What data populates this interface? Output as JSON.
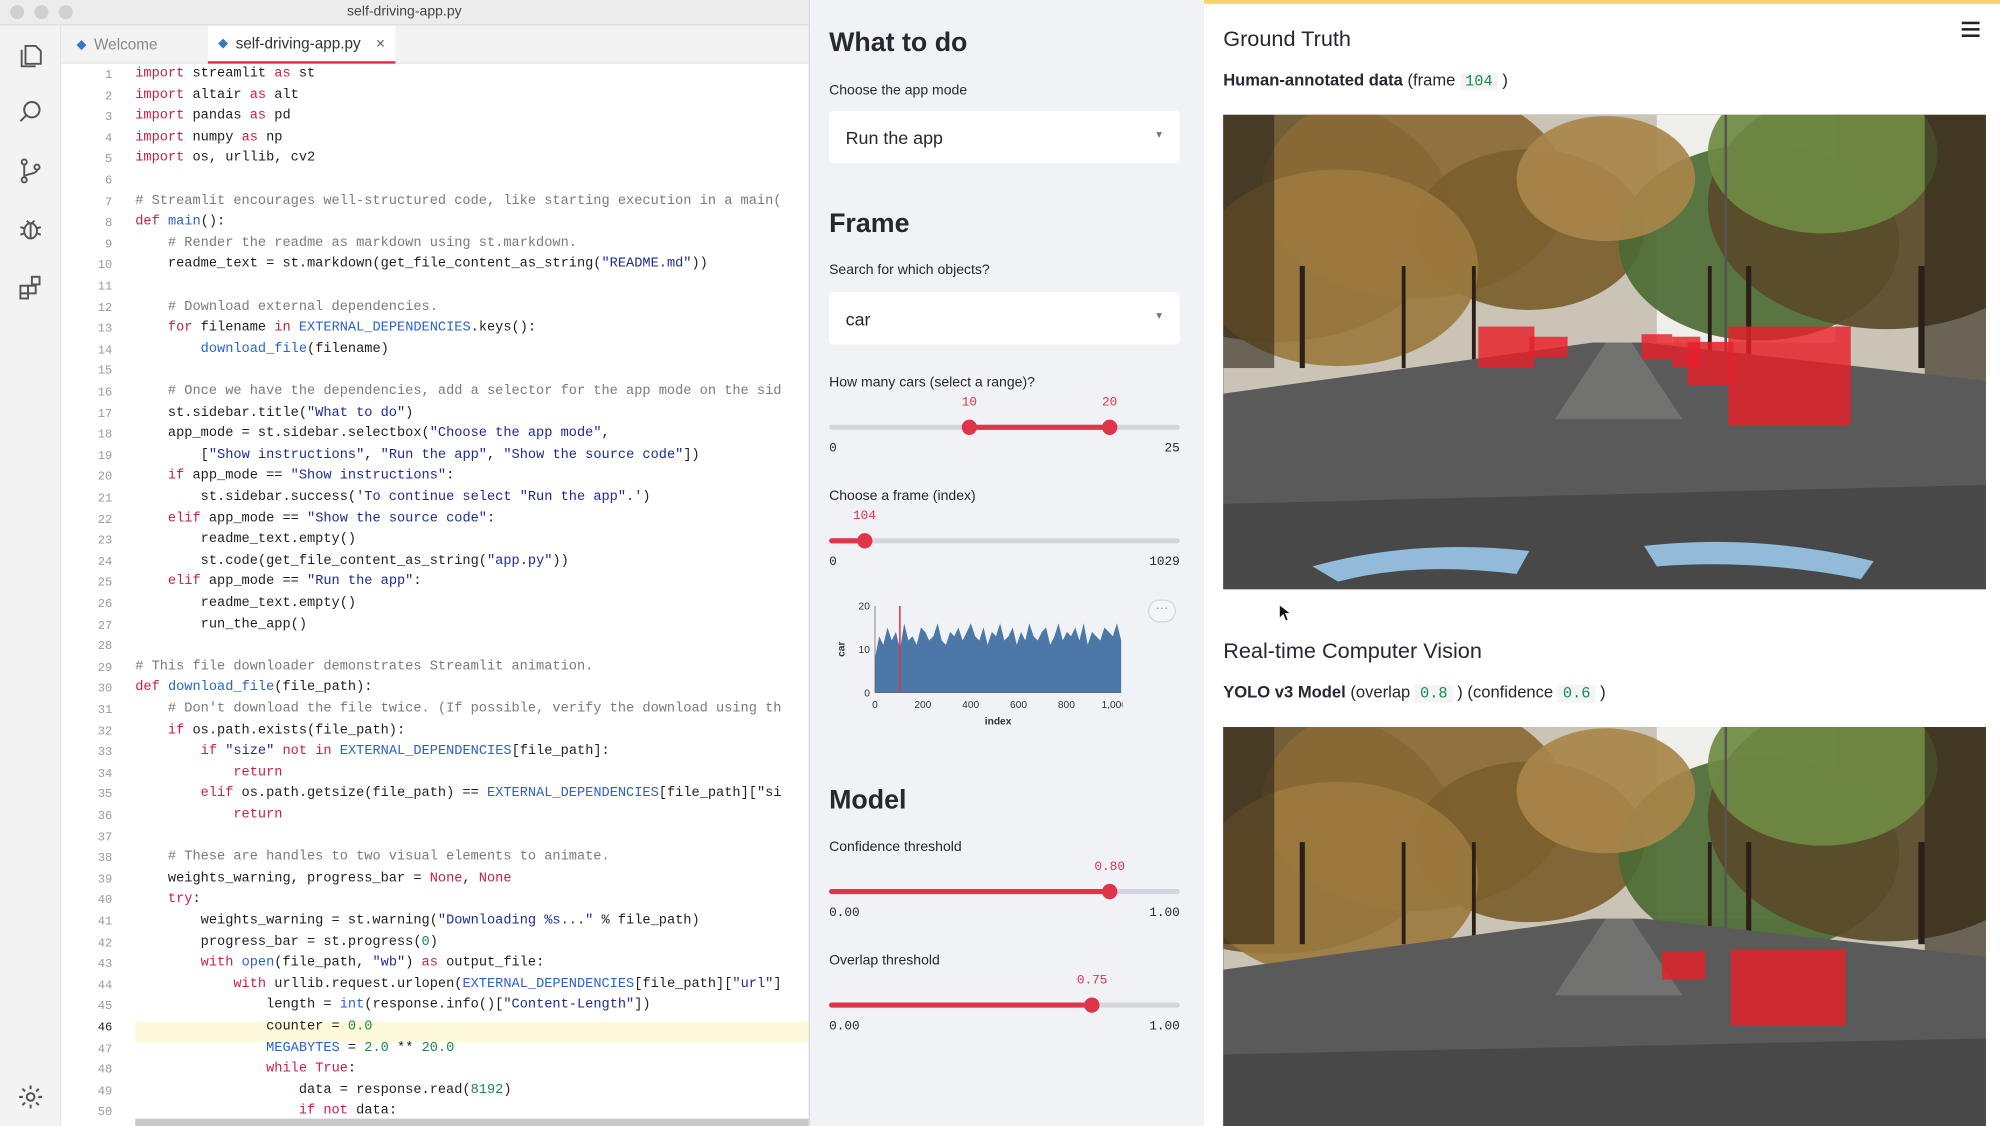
{
  "window": {
    "title": "self-driving-app.py"
  },
  "tabs": [
    {
      "label": "Welcome",
      "icon": "vscode-icon"
    },
    {
      "label": "self-driving-app.py",
      "icon": "python-file-icon",
      "close": "×"
    }
  ],
  "activity_icons": [
    "files-icon",
    "search-icon",
    "source-control-icon",
    "debug-icon",
    "extensions-icon",
    "settings-gear-icon"
  ],
  "editor": {
    "current_line": 46,
    "lines": [
      "import streamlit as st",
      "import altair as alt",
      "import pandas as pd",
      "import numpy as np",
      "import os, urllib, cv2",
      "",
      "# Streamlit encourages well-structured code, like starting execution in a main(",
      "def main():",
      "    # Render the readme as markdown using st.markdown.",
      "    readme_text = st.markdown(get_file_content_as_string(\"README.md\"))",
      "",
      "    # Download external dependencies.",
      "    for filename in EXTERNAL_DEPENDENCIES.keys():",
      "        download_file(filename)",
      "",
      "    # Once we have the dependencies, add a selector for the app mode on the sid",
      "    st.sidebar.title(\"What to do\")",
      "    app_mode = st.sidebar.selectbox(\"Choose the app mode\",",
      "        [\"Show instructions\", \"Run the app\", \"Show the source code\"])",
      "    if app_mode == \"Show instructions\":",
      "        st.sidebar.success('To continue select \"Run the app\".')",
      "    elif app_mode == \"Show the source code\":",
      "        readme_text.empty()",
      "        st.code(get_file_content_as_string(\"app.py\"))",
      "    elif app_mode == \"Run the app\":",
      "        readme_text.empty()",
      "        run_the_app()",
      "",
      "# This file downloader demonstrates Streamlit animation.",
      "def download_file(file_path):",
      "    # Don't download the file twice. (If possible, verify the download using th",
      "    if os.path.exists(file_path):",
      "        if \"size\" not in EXTERNAL_DEPENDENCIES[file_path]:",
      "            return",
      "        elif os.path.getsize(file_path) == EXTERNAL_DEPENDENCIES[file_path][\"si",
      "            return",
      "",
      "    # These are handles to two visual elements to animate.",
      "    weights_warning, progress_bar = None, None",
      "    try:",
      "        weights_warning = st.warning(\"Downloading %s...\" % file_path)",
      "        progress_bar = st.progress(0)",
      "        with open(file_path, \"wb\") as output_file:",
      "            with urllib.request.urlopen(EXTERNAL_DEPENDENCIES[file_path][\"url\"]",
      "                length = int(response.info()[\"Content-Length\"])",
      "                counter = 0.0",
      "                MEGABYTES = 2.0 ** 20.0",
      "                while True:",
      "                    data = response.read(8192)",
      "                    if not data:"
    ]
  },
  "sidebar": {
    "what_to_do": "What to do",
    "app_mode_label": "Choose the app mode",
    "app_mode_value": "Run the app",
    "frame_heading": "Frame",
    "objects_label": "Search for which objects?",
    "objects_value": "car",
    "cars_label": "How many cars (select a range)?",
    "cars_range": {
      "low": 10,
      "high": 20,
      "min": 0,
      "max": 25,
      "low_text": "10",
      "high_text": "20",
      "min_text": "0",
      "max_text": "25"
    },
    "frame_label": "Choose a frame (index)",
    "frame_slider": {
      "value": 104,
      "min": 0,
      "max": 1029,
      "value_text": "104",
      "min_text": "0",
      "max_text": "1029"
    },
    "model_heading": "Model",
    "confidence_label": "Confidence threshold",
    "confidence": {
      "value": 0.8,
      "min": 0,
      "max": 1,
      "value_text": "0.80",
      "min_text": "0.00",
      "max_text": "1.00"
    },
    "overlap_label": "Overlap threshold",
    "overlap": {
      "value": 0.75,
      "min": 0,
      "max": 1,
      "value_text": "0.75",
      "min_text": "0.00",
      "max_text": "1.00"
    },
    "chart_more": "···"
  },
  "chart_data": {
    "type": "area",
    "ylabel": "car",
    "xlabel": "index",
    "x_ticks": [
      "0",
      "200",
      "400",
      "600",
      "800",
      "1,000"
    ],
    "y_ticks": [
      "0",
      "10",
      "20"
    ],
    "xlim": [
      0,
      1029
    ],
    "ylim": [
      0,
      20
    ],
    "selected_index": 104,
    "color": "#4c78a8",
    "rule_color": "#e0344b",
    "approx_profile": [
      8,
      13,
      11,
      15,
      12,
      14,
      10,
      16,
      12,
      13,
      11,
      15,
      14,
      12,
      13,
      16,
      12,
      11,
      14,
      13,
      15,
      12,
      14,
      16,
      13,
      12,
      15,
      11,
      14,
      13,
      16,
      12,
      13,
      15,
      11,
      14,
      12,
      16,
      13,
      12,
      14,
      15,
      11,
      13,
      16,
      12,
      14,
      13,
      15,
      12,
      16,
      11,
      14,
      13,
      12,
      15,
      14,
      13,
      16,
      12
    ]
  },
  "main": {
    "ground_truth_title": "Ground Truth",
    "gt_subtitle_bold": "Human-annotated data",
    "gt_subtitle_pre": "(frame",
    "gt_frame": "104",
    "gt_subtitle_post": ")",
    "cv_title": "Real-time Computer Vision",
    "cv_subtitle_bold": "YOLO v3 Model",
    "cv_overlap_pre": "(overlap",
    "cv_overlap": "0.8",
    "cv_conf_pre": ") (confidence",
    "cv_conf": "0.6",
    "cv_post": ")"
  },
  "colors": {
    "accent": "#e0344b",
    "sidebar_bg": "#f0f2f6",
    "box": "#e8202a"
  }
}
